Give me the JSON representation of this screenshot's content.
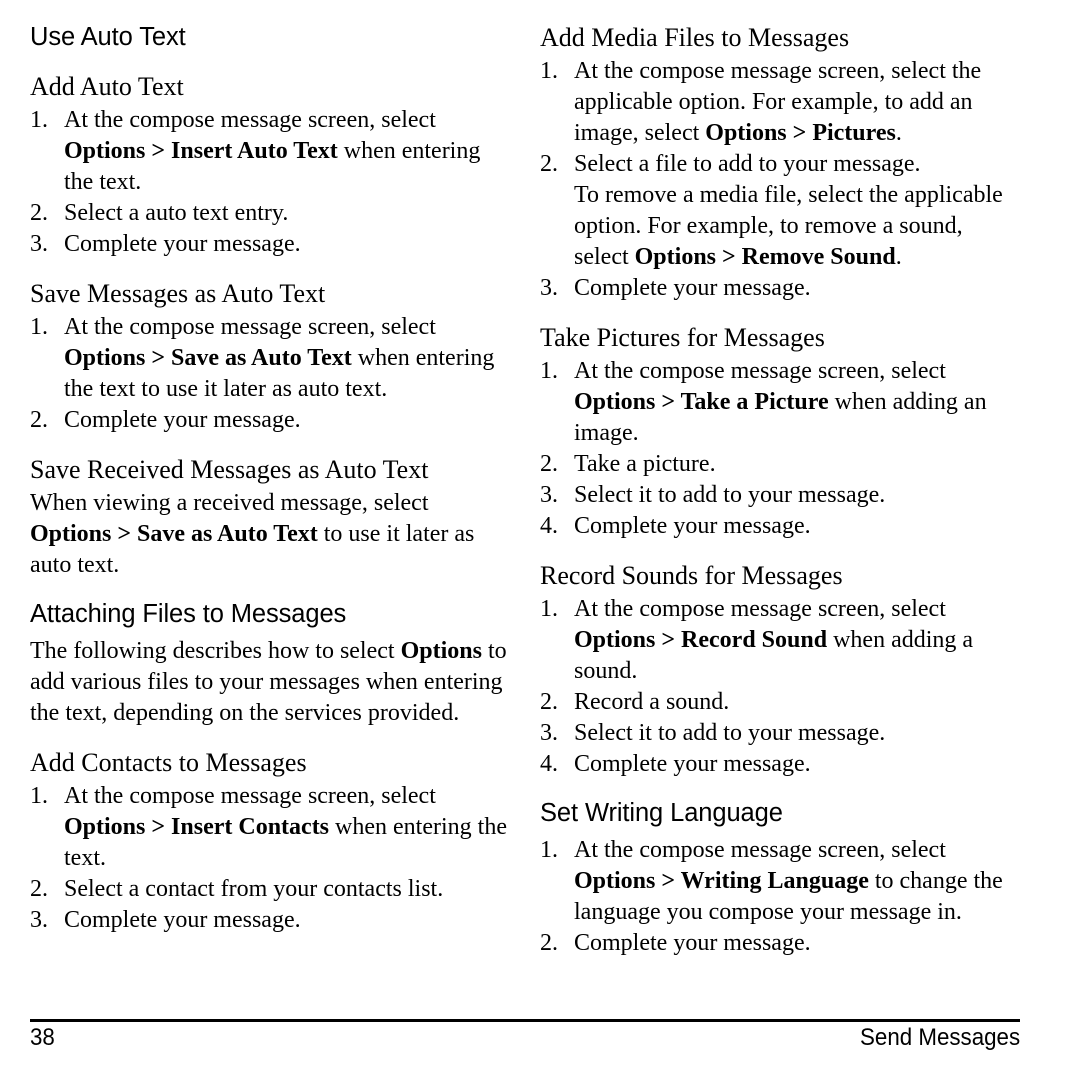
{
  "page": {
    "number": "38",
    "section_name": "Send Messages",
    "background_color": "#ffffff",
    "text_color": "#000000"
  },
  "left_column": {
    "sections": [
      {
        "id": "use-auto-text",
        "heading": "Use Auto Text",
        "heading_level": 1
      },
      {
        "id": "add-auto-text",
        "heading": "Add Auto Text",
        "heading_level": 2,
        "steps": [
          {
            "num": "1.",
            "parts": [
              {
                "text": "At the compose message screen, select ",
                "bold": false
              },
              {
                "text": "Options > Insert Auto Text",
                "bold": true
              },
              {
                "text": " when entering the text.",
                "bold": false
              }
            ]
          },
          {
            "num": "2.",
            "parts": [
              {
                "text": "Select a auto text entry.",
                "bold": false
              }
            ]
          },
          {
            "num": "3.",
            "parts": [
              {
                "text": "Complete your message.",
                "bold": false
              }
            ]
          }
        ]
      },
      {
        "id": "save-messages-as-auto-text",
        "heading": "Save Messages as Auto Text",
        "heading_level": 2,
        "steps": [
          {
            "num": "1.",
            "parts": [
              {
                "text": "At the compose message screen, select ",
                "bold": false
              },
              {
                "text": "Options > Save as Auto Text",
                "bold": true
              },
              {
                "text": " when entering the text to use it later as auto text.",
                "bold": false
              }
            ]
          },
          {
            "num": "2.",
            "parts": [
              {
                "text": "Complete your message.",
                "bold": false
              }
            ]
          }
        ]
      },
      {
        "id": "save-received-messages-as-auto-text",
        "heading": "Save Received Messages as Auto Text",
        "heading_level": 2,
        "paragraphs": [
          [
            {
              "text": "When viewing a received message, select ",
              "bold": false
            },
            {
              "text": "Options > Save as Auto Text",
              "bold": true
            },
            {
              "text": " to use it later as auto text.",
              "bold": false
            }
          ]
        ]
      },
      {
        "id": "attaching-files-to-messages",
        "heading": "Attaching Files to Messages",
        "heading_level": 1,
        "paragraphs": [
          [
            {
              "text": "The following describes how to select ",
              "bold": false
            },
            {
              "text": "Options",
              "bold": true
            },
            {
              "text": " to add various files to your messages when entering the text, depending on the services provided.",
              "bold": false
            }
          ]
        ]
      },
      {
        "id": "add-contacts-to-messages",
        "heading": "Add Contacts to Messages",
        "heading_level": 2,
        "steps": [
          {
            "num": "1.",
            "parts": [
              {
                "text": "At the compose message screen, select ",
                "bold": false
              },
              {
                "text": "Options > Insert Contacts",
                "bold": true
              },
              {
                "text": " when entering the text.",
                "bold": false
              }
            ]
          },
          {
            "num": "2.",
            "parts": [
              {
                "text": "Select a contact from your contacts list.",
                "bold": false
              }
            ]
          },
          {
            "num": "3.",
            "parts": [
              {
                "text": "Complete your message.",
                "bold": false
              }
            ]
          }
        ]
      }
    ]
  },
  "right_column": {
    "sections": [
      {
        "id": "add-media-files-to-messages",
        "heading": "Add Media Files to Messages",
        "heading_level": 2,
        "steps": [
          {
            "num": "1.",
            "parts": [
              {
                "text": "At the compose message screen, select the applicable option. For example, to add an image, select ",
                "bold": false
              },
              {
                "text": "Options > Pictures",
                "bold": true
              },
              {
                "text": ".",
                "bold": false
              }
            ]
          },
          {
            "num": "2.",
            "parts": [
              {
                "text": "Select a file to add to your message.",
                "bold": false
              }
            ],
            "continuation": [
              {
                "text": "To remove a media file, select the applicable option. For example, to remove a sound, select ",
                "bold": false
              },
              {
                "text": "Options > Remove Sound",
                "bold": true
              },
              {
                "text": ".",
                "bold": false
              }
            ]
          },
          {
            "num": "3.",
            "parts": [
              {
                "text": "Complete your message.",
                "bold": false
              }
            ]
          }
        ]
      },
      {
        "id": "take-pictures-for-messages",
        "heading": "Take Pictures for Messages",
        "heading_level": 2,
        "steps": [
          {
            "num": "1.",
            "parts": [
              {
                "text": "At the compose message screen, select ",
                "bold": false
              },
              {
                "text": "Options > Take a Picture",
                "bold": true
              },
              {
                "text": " when adding an image.",
                "bold": false
              }
            ]
          },
          {
            "num": "2.",
            "parts": [
              {
                "text": "Take a picture.",
                "bold": false
              }
            ]
          },
          {
            "num": "3.",
            "parts": [
              {
                "text": "Select it to add to your message.",
                "bold": false
              }
            ]
          },
          {
            "num": "4.",
            "parts": [
              {
                "text": "Complete your message.",
                "bold": false
              }
            ]
          }
        ]
      },
      {
        "id": "record-sounds-for-messages",
        "heading": "Record Sounds for Messages",
        "heading_level": 2,
        "steps": [
          {
            "num": "1.",
            "parts": [
              {
                "text": "At the compose message screen, select ",
                "bold": false
              },
              {
                "text": "Options > Record Sound",
                "bold": true
              },
              {
                "text": " when adding a sound.",
                "bold": false
              }
            ]
          },
          {
            "num": "2.",
            "parts": [
              {
                "text": "Record a sound.",
                "bold": false
              }
            ]
          },
          {
            "num": "3.",
            "parts": [
              {
                "text": "Select it to add to your message.",
                "bold": false
              }
            ]
          },
          {
            "num": "4.",
            "parts": [
              {
                "text": "Complete your message.",
                "bold": false
              }
            ]
          }
        ]
      },
      {
        "id": "set-writing-language",
        "heading": "Set Writing Language",
        "heading_level": 1,
        "steps": [
          {
            "num": "1.",
            "parts": [
              {
                "text": "At the compose message screen, select ",
                "bold": false
              },
              {
                "text": "Options > Writing Language",
                "bold": true
              },
              {
                "text": " to change the language you compose your message in.",
                "bold": false
              }
            ]
          },
          {
            "num": "2.",
            "parts": [
              {
                "text": "Complete your message.",
                "bold": false
              }
            ]
          }
        ]
      }
    ]
  }
}
